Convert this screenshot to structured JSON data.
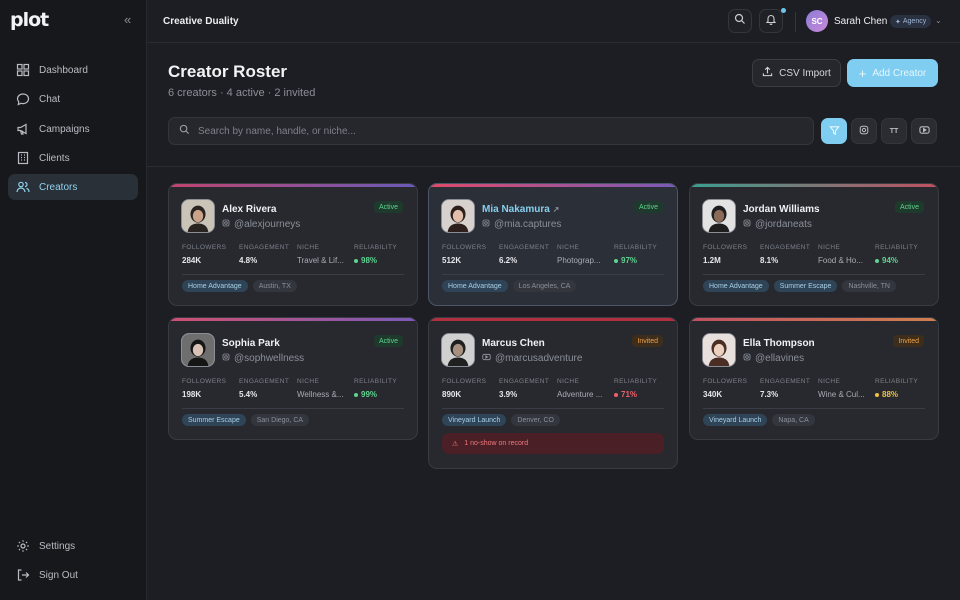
{
  "app": {
    "logo": "plot",
    "workspace": "Creative Duality"
  },
  "sidebar": {
    "items": [
      {
        "label": "Dashboard",
        "icon": "grid-icon"
      },
      {
        "label": "Chat",
        "icon": "chat-icon"
      },
      {
        "label": "Campaigns",
        "icon": "megaphone-icon"
      },
      {
        "label": "Clients",
        "icon": "building-icon"
      },
      {
        "label": "Creators",
        "icon": "users-icon",
        "active": true
      }
    ],
    "bottom": [
      {
        "label": "Settings",
        "icon": "gear-icon"
      },
      {
        "label": "Sign Out",
        "icon": "sign-out-icon"
      }
    ]
  },
  "user": {
    "initials": "SC",
    "name": "Sarah Chen",
    "role": "Agency"
  },
  "header": {
    "title": "Creator Roster",
    "subtitle": "6 creators · 4 active · 2 invited",
    "csv_label": "CSV Import",
    "add_label": "Add Creator"
  },
  "search": {
    "placeholder": "Search by name, handle, or niche...",
    "tiktok_label": "TT"
  },
  "labels": {
    "followers": "FOLLOWERS",
    "engagement": "ENGAGEMENT",
    "niche": "NICHE",
    "reliability": "RELIABILITY"
  },
  "colors": {
    "accent": "#7fcdf0",
    "active": "#5fd38f",
    "invited": "#f0a04a",
    "danger": "#f0606a",
    "warn": "#f0c040"
  },
  "creators": [
    {
      "name": "Alex Rivera",
      "handle": "@alexjourneys",
      "platform": "instagram",
      "status": "Active",
      "followers": "284K",
      "engagement": "4.8%",
      "niche": "Travel & Lif...",
      "reliability": "98%",
      "campaigns": [
        "Home Advantage"
      ],
      "location": "Austin, TX"
    },
    {
      "name": "Mia Nakamura",
      "handle": "@mia.captures",
      "platform": "instagram",
      "status": "Active",
      "followers": "512K",
      "engagement": "6.2%",
      "niche": "Photograp...",
      "reliability": "97%",
      "campaigns": [
        "Home Advantage"
      ],
      "location": "Los Angeles, CA"
    },
    {
      "name": "Jordan Williams",
      "handle": "@jordaneats",
      "platform": "instagram",
      "status": "Active",
      "followers": "1.2M",
      "engagement": "8.1%",
      "niche": "Food & Ho...",
      "reliability": "94%",
      "campaigns": [
        "Home Advantage",
        "Summer Escape"
      ],
      "location": "Nashville, TN"
    },
    {
      "name": "Sophia Park",
      "handle": "@sophwellness",
      "platform": "instagram",
      "status": "Active",
      "followers": "198K",
      "engagement": "5.4%",
      "niche": "Wellness &...",
      "reliability": "99%",
      "campaigns": [
        "Summer Escape"
      ],
      "location": "San Diego, CA"
    },
    {
      "name": "Marcus Chen",
      "handle": "@marcusadventure",
      "platform": "youtube",
      "status": "Invited",
      "followers": "890K",
      "engagement": "3.9%",
      "niche": "Adventure ...",
      "reliability": "71%",
      "campaigns": [
        "Vineyard Launch"
      ],
      "location": "Denver, CO",
      "warning": "1 no-show on record"
    },
    {
      "name": "Ella Thompson",
      "handle": "@ellavines",
      "platform": "instagram",
      "status": "Invited",
      "followers": "340K",
      "engagement": "7.3%",
      "niche": "Wine & Cul...",
      "reliability": "88%",
      "campaigns": [
        "Vineyard Launch"
      ],
      "location": "Napa, CA"
    }
  ]
}
